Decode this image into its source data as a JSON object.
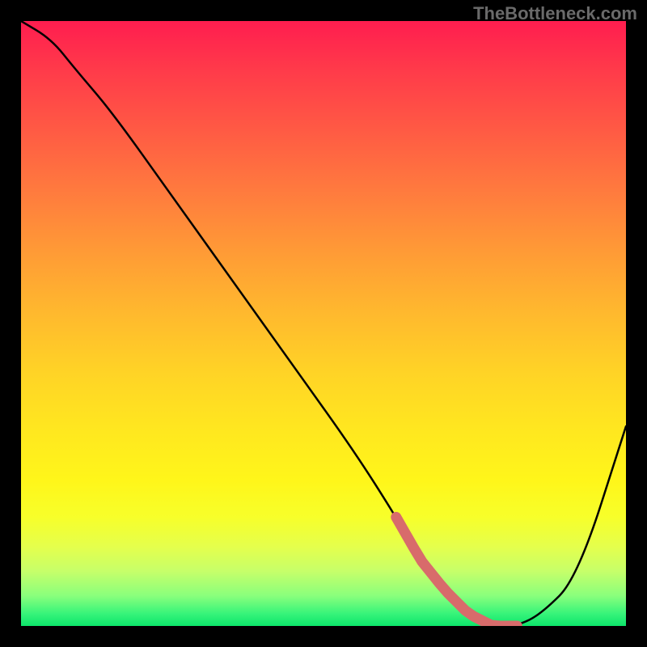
{
  "watermark": "TheBottleneck.com",
  "chart_data": {
    "type": "line",
    "title": "",
    "xlabel": "",
    "ylabel": "",
    "xlim": [
      0,
      100
    ],
    "ylim": [
      0,
      100
    ],
    "x": [
      0,
      5,
      9,
      15,
      25,
      35,
      45,
      55,
      62,
      66,
      70,
      74,
      78,
      82,
      86,
      92,
      100
    ],
    "values": [
      100,
      97,
      92,
      85,
      71,
      57,
      43,
      29,
      18,
      11,
      6,
      2,
      0,
      0,
      2,
      8,
      33
    ],
    "notes": "Single V-shaped curve over a vertical rainbow gradient. The trough (y≈0) sits at roughly x 74–82. Values are approximate, read from the plot. x-axis left→right 0–100, y-axis bottom→top 0–100."
  },
  "marker": {
    "color": "#d86b6b",
    "stroke_width": 13,
    "x_range": [
      62,
      82
    ],
    "comment": "Thick salmon segment overlaid on the curve near the trough."
  },
  "colors": {
    "page_bg": "#000000",
    "curve": "#000000",
    "watermark": "#6a6a6a"
  }
}
